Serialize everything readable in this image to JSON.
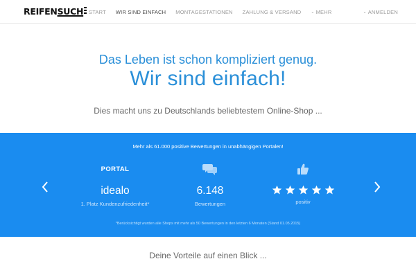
{
  "nav": {
    "logo_part1": "REIFEN",
    "logo_part2": "SUCH",
    "links": [
      "START",
      "WIR SIND EINFACH",
      "MONTAGESTATIONEN",
      "ZAHLUNG & VERSAND"
    ],
    "more_label": "MEHR",
    "login_label": "ANMELDEN",
    "active_index": 1
  },
  "hero": {
    "line1": "Das Leben ist schon kompliziert genug.",
    "line2": "Wir sind einfach!",
    "subline": "Dies macht uns zu Deutschlands beliebtestem Online-Shop ..."
  },
  "band": {
    "headline": "Mehr als 61.000 positive Bewertungen in unabhängigen Portalen!",
    "col1": {
      "header": "PORTAL",
      "value": "idealo",
      "caption": "1. Platz Kundenzufriedenheit*"
    },
    "col2": {
      "icon": "speech-bubbles-icon",
      "value": "6.148",
      "caption": "Bewertungen"
    },
    "col3": {
      "icon": "thumbs-up-icon",
      "stars": 5,
      "caption": "positiv"
    },
    "footnote": "*Berücksichtigt wurden alle Shops mit mehr als 50 Bewertungen in den letzten 6 Monaten (Stand 01.05.2015)"
  },
  "section": {
    "title": "Deine Vorteile auf einen Blick ..."
  },
  "colors": {
    "accent": "#1a8cf0",
    "heading_blue": "#2a8fd8"
  }
}
